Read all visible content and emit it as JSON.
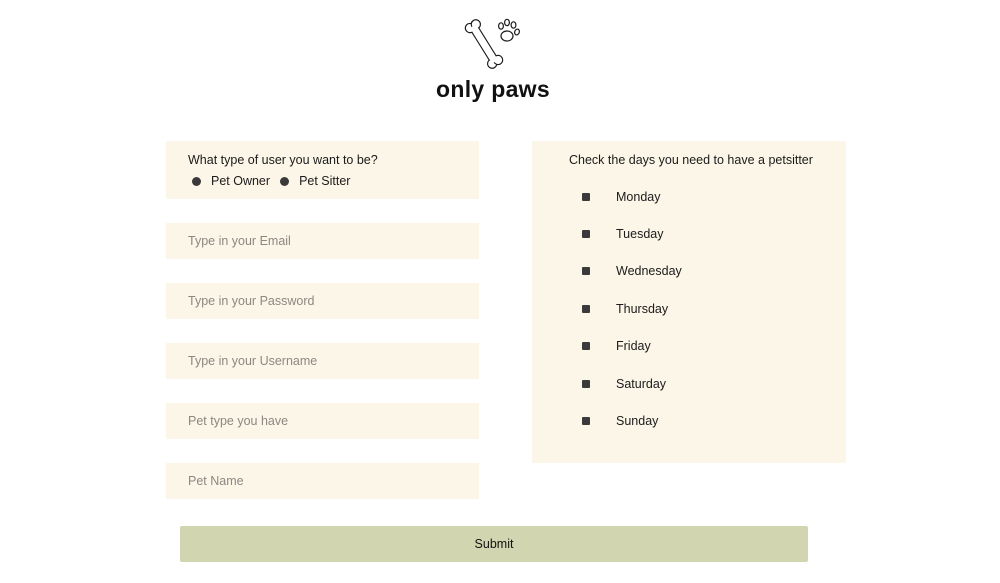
{
  "brand": {
    "name": "only paws",
    "logo_icon": "bone-and-paw-icon"
  },
  "user_type": {
    "question": "What type of user you want to be?",
    "options": [
      "Pet Owner",
      "Pet Sitter"
    ]
  },
  "fields": {
    "email_placeholder": "Type in your Email",
    "password_placeholder": "Type in your Password",
    "username_placeholder": "Type in your Username",
    "pet_type_placeholder": "Pet type you have",
    "pet_name_placeholder": "Pet Name"
  },
  "days": {
    "question": "Check the days you need to have a petsitter",
    "items": [
      "Monday",
      "Tuesday",
      "Wednesday",
      "Thursday",
      "Friday",
      "Saturday",
      "Sunday"
    ]
  },
  "submit_label": "Submit",
  "colors": {
    "panel_background": "#fcf6e8",
    "submit_background": "#d1d6b1",
    "control_fill": "#3a3a3a"
  }
}
